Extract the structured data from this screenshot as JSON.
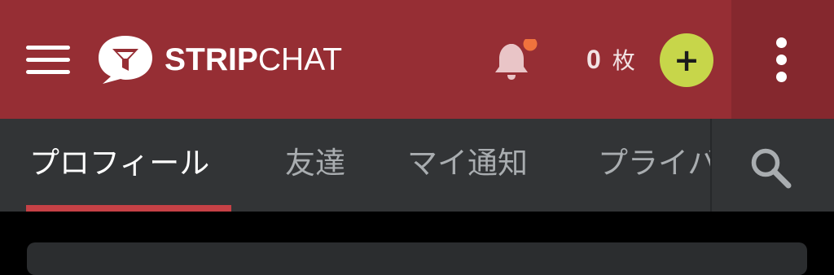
{
  "header": {
    "brand_bold": "STRIP",
    "brand_regular": "CHAT",
    "token_count": "0",
    "token_unit": "枚",
    "add_label": "+",
    "icons": {
      "menu": "hamburger-menu-icon",
      "logo": "speech-bubble-logo-icon",
      "notifications": "bell-icon",
      "more": "vertical-dots-icon"
    },
    "colors": {
      "background": "#962e34",
      "more_background": "#85282e",
      "notification_dot": "#f0733d",
      "add_button": "#c7d64a"
    }
  },
  "tabs": {
    "items": [
      {
        "label": "プロフィール",
        "active": true
      },
      {
        "label": "友達",
        "active": false
      },
      {
        "label": "マイ通知",
        "active": false
      },
      {
        "label": "プライバシー",
        "active": false
      }
    ],
    "search_icon": "search-icon",
    "colors": {
      "background": "#323436",
      "active_text": "#ffffff",
      "inactive_text": "#a9adb0",
      "underline": "#c64146"
    }
  }
}
